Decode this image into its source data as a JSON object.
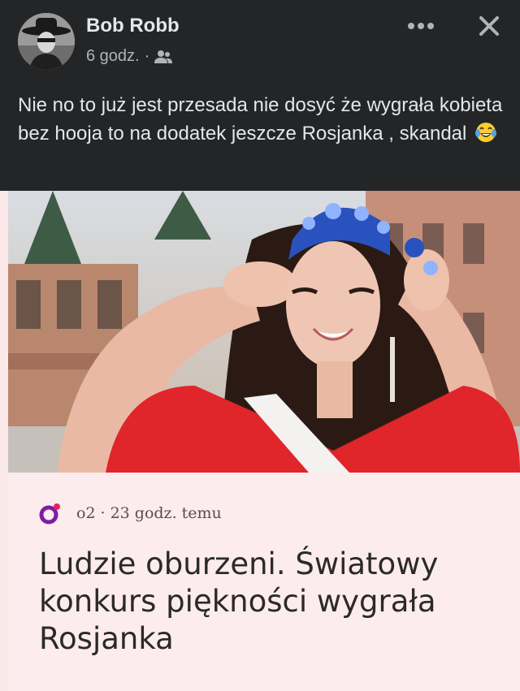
{
  "post": {
    "author": "Bob Robb",
    "time": "6 godz.",
    "separator": "·",
    "audience_icon": "friends-icon",
    "caption": "Nie no to już jest przesada nie dosyć że wygrała kobieta bez hooja to na dodatek jeszcze Rosjanka , skandal",
    "caption_emoji": "tears-of-joy-emoji"
  },
  "actions": {
    "more_icon": "more-dots-icon",
    "close_icon": "close-icon"
  },
  "article": {
    "source": "o2",
    "separator": "·",
    "time": "23 godz. temu",
    "headline": "Ludzie oburzeni. Światowy konkurs piękności wygrała Rosjanka"
  },
  "colors": {
    "background": "#242526",
    "text_primary": "#e4e6eb",
    "text_secondary": "#b0b3b8",
    "card_background": "#fdeced",
    "dress_red": "#e0252b",
    "crown_blue": "#2a52be",
    "brand_o2": "#7b1fa2"
  }
}
